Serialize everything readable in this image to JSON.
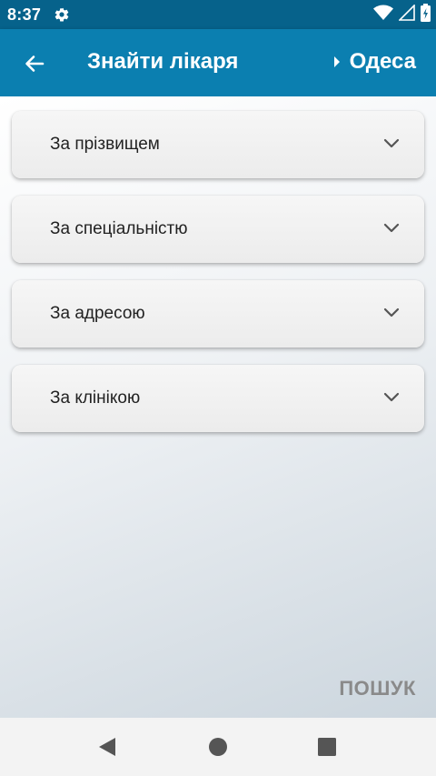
{
  "status_bar": {
    "time": "8:37",
    "icons": [
      "gear-icon",
      "wifi-icon",
      "signal-icon",
      "battery-icon"
    ]
  },
  "app_bar": {
    "title": "Знайти лікаря",
    "city": "Одеса",
    "colors": {
      "app_bar": "#0b7fb0",
      "status_bar": "#06628b"
    }
  },
  "filters": [
    {
      "label": "За прізвищем"
    },
    {
      "label": "За спеціальністю"
    },
    {
      "label": "За адресою"
    },
    {
      "label": "За клінікою"
    }
  ],
  "actions": {
    "search_label": "ПОШУК"
  }
}
